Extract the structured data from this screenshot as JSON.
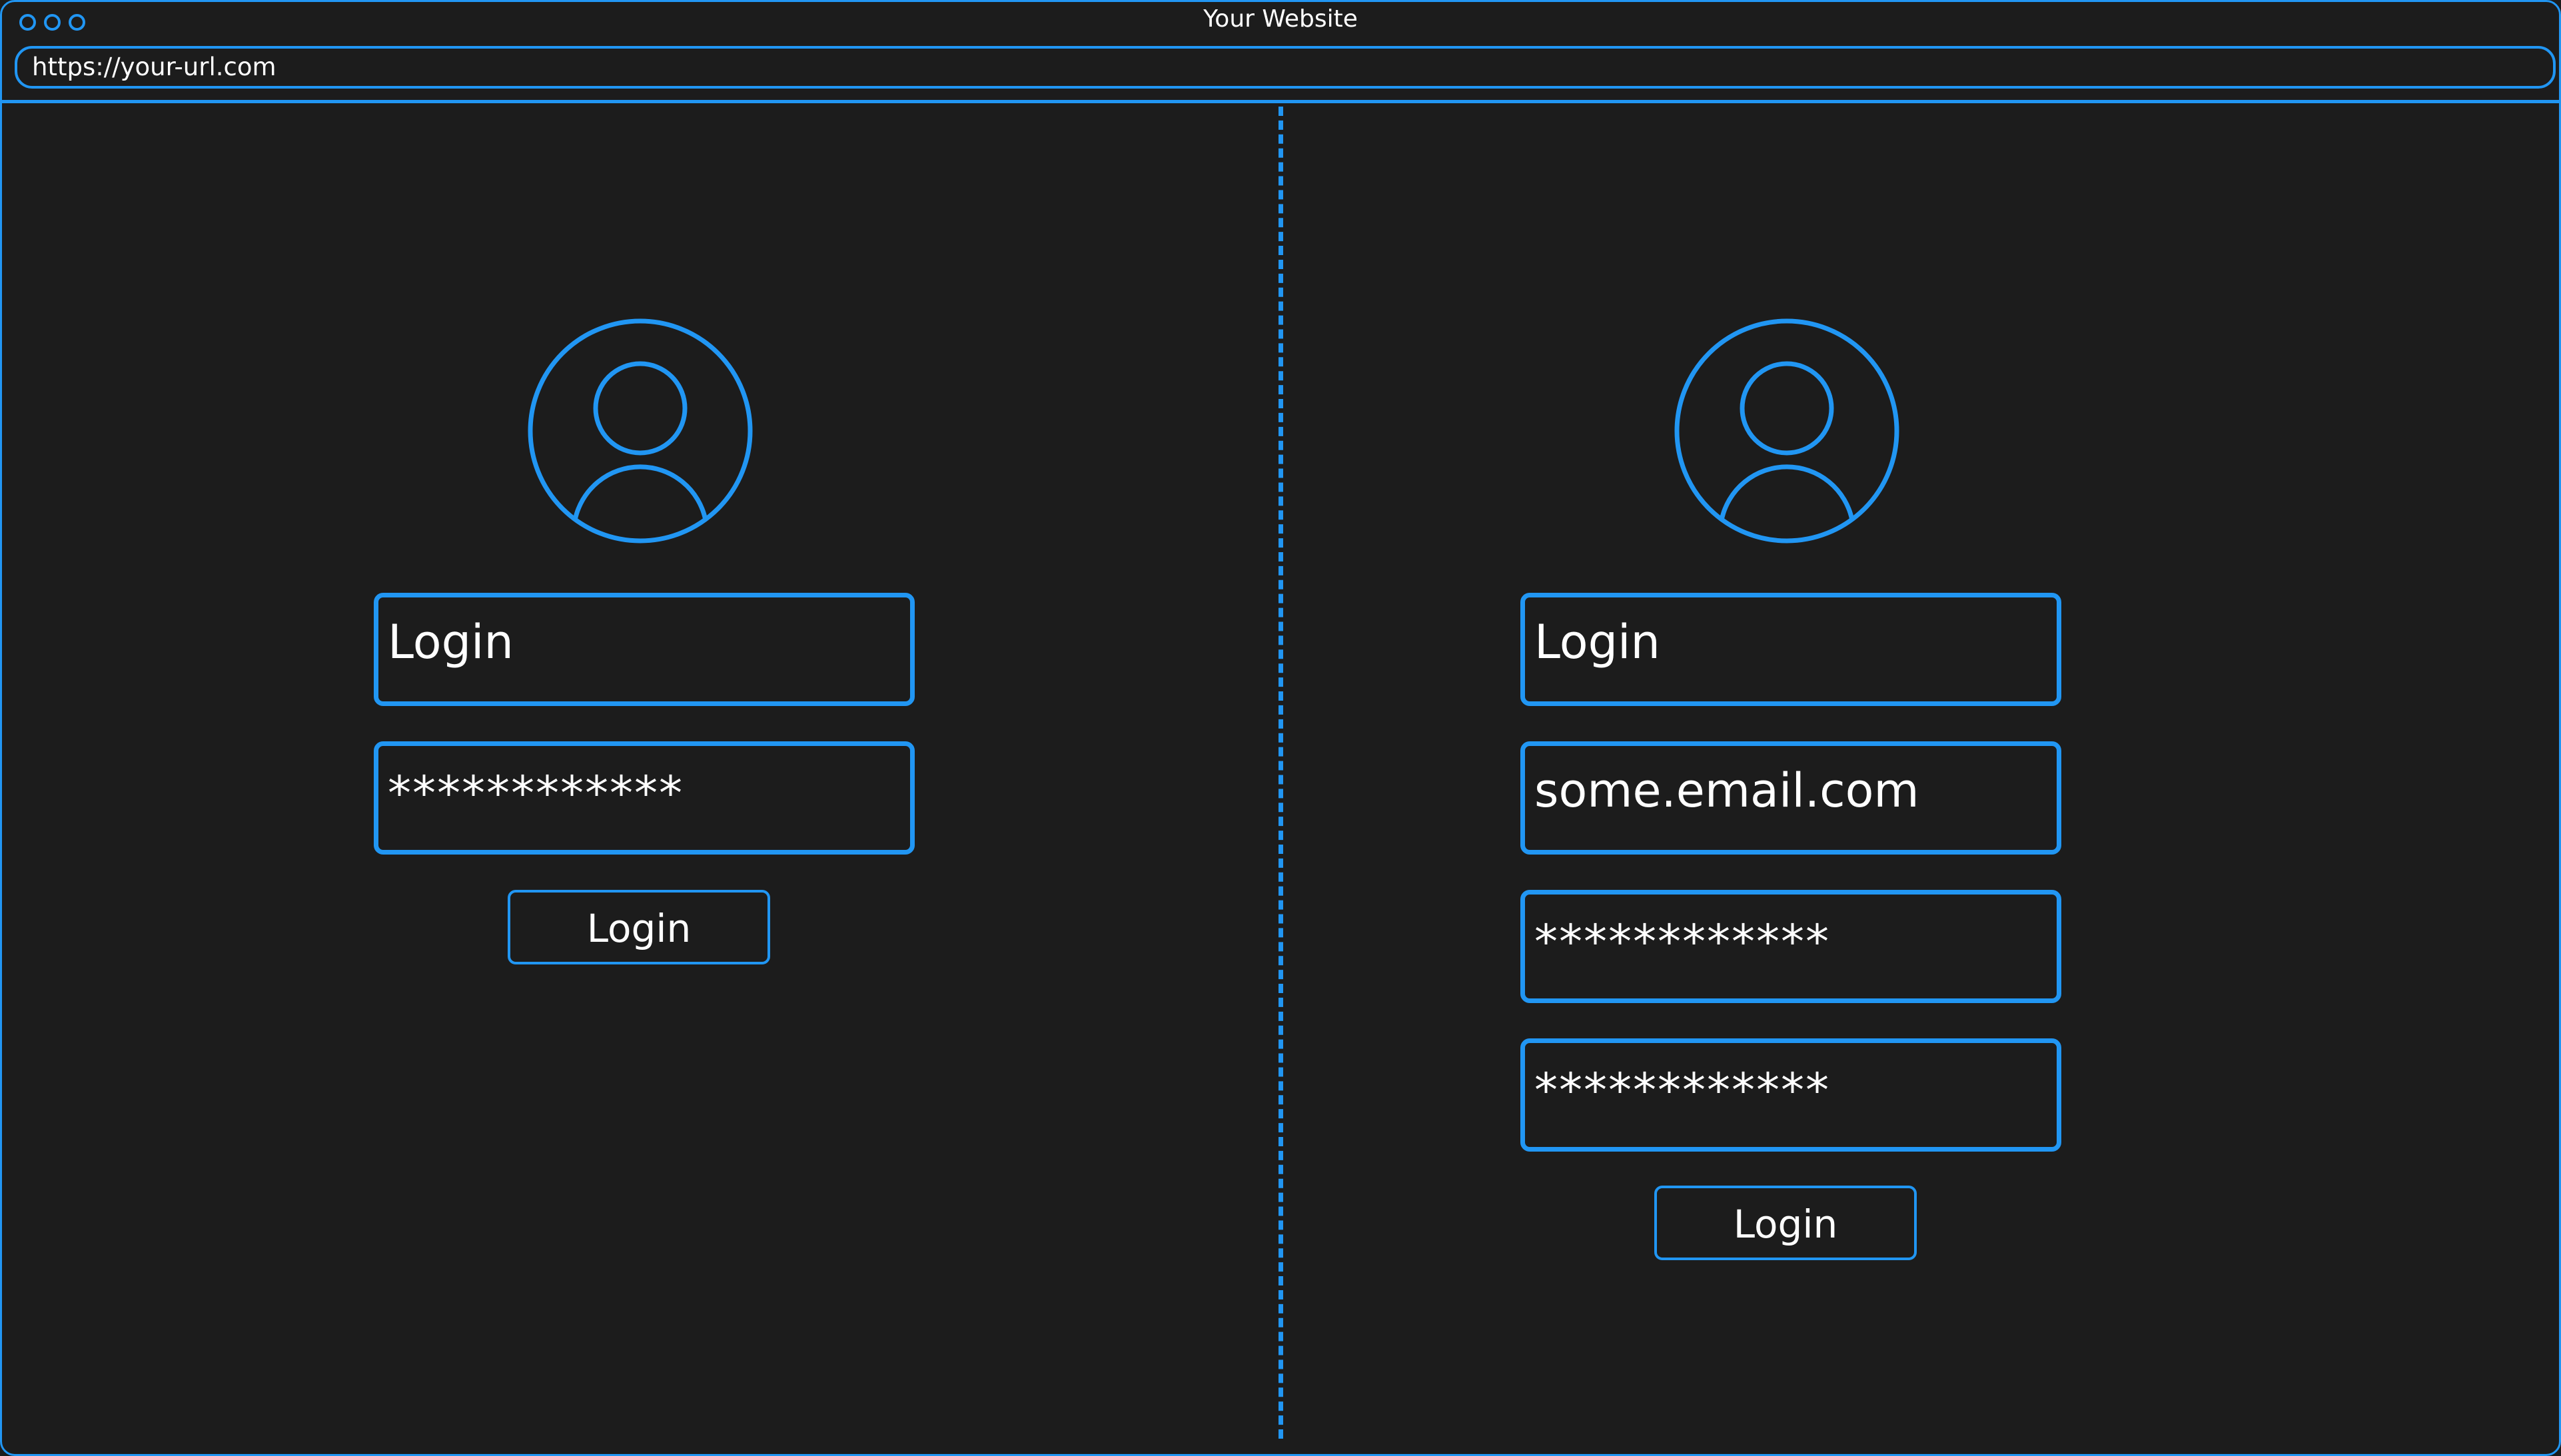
{
  "window": {
    "title": "Your Website",
    "url": "https://your-url.com"
  },
  "left_panel": {
    "login_field": "Login",
    "password_field": "************",
    "login_button": "Login"
  },
  "right_panel": {
    "login_field": "Login",
    "email_field": "some.email.com",
    "password_field": "************",
    "confirm_password_field": "************",
    "login_button": "Login"
  },
  "colors": {
    "accent": "#2196f3",
    "background": "#1c1c1c",
    "text": "#ffffff"
  }
}
